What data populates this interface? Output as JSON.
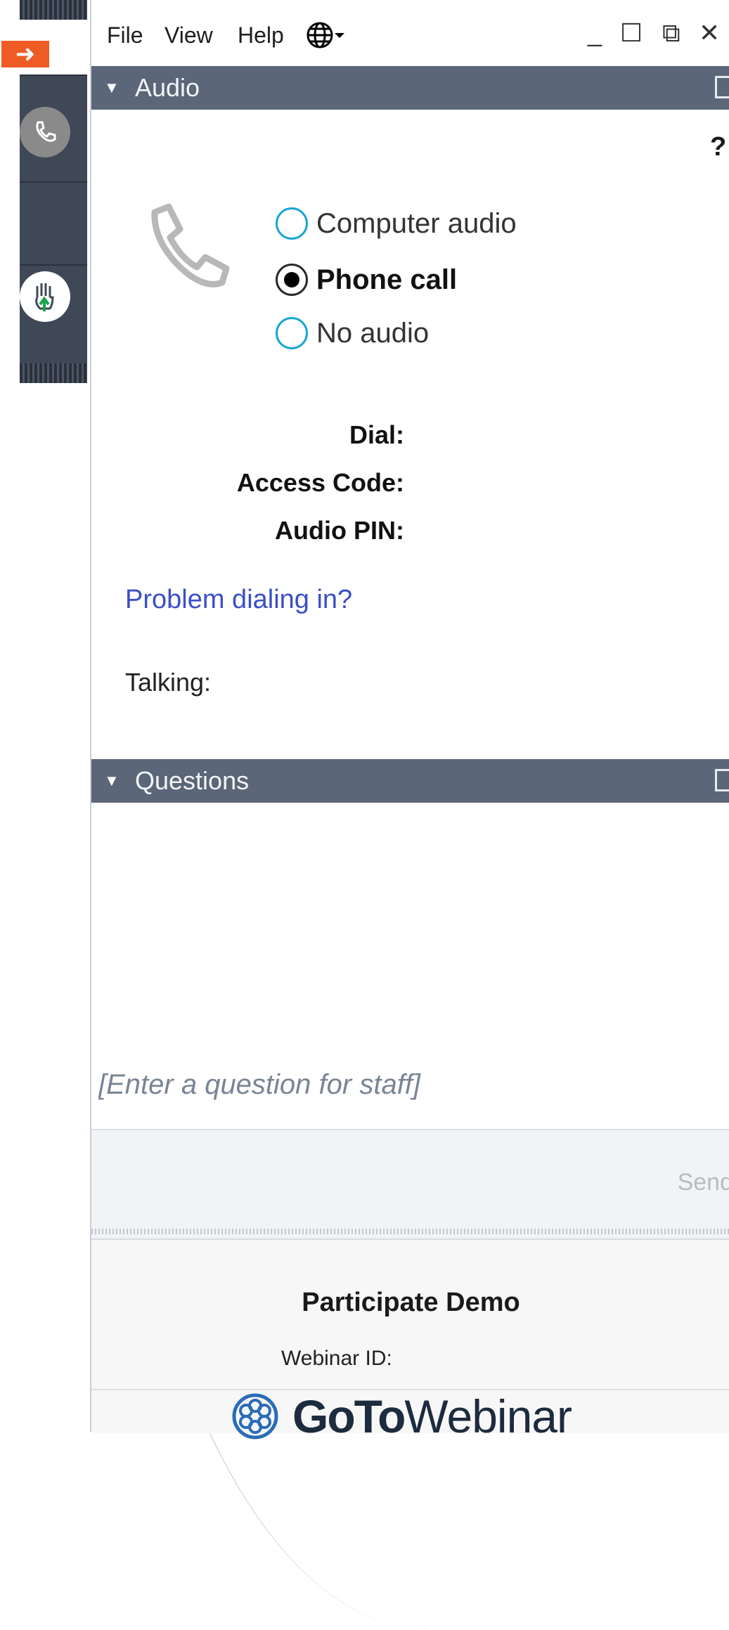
{
  "menu": {
    "file": "File",
    "view": "View",
    "help": "Help"
  },
  "window_controls": {
    "minimize": "_",
    "maximize": "☐",
    "popout": "⧉",
    "close": "✕"
  },
  "audio_panel": {
    "title": "Audio",
    "help": "?",
    "options": [
      {
        "label": "Computer audio",
        "selected": false
      },
      {
        "label": "Phone call",
        "selected": true
      },
      {
        "label": "No audio",
        "selected": false
      }
    ],
    "fields": {
      "dial": "Dial:",
      "access_code": "Access Code:",
      "audio_pin": "Audio PIN:"
    },
    "problem_link": "Problem dialing in?",
    "talking": "Talking:"
  },
  "questions_panel": {
    "title": "Questions",
    "placeholder": "[Enter a question for staff]",
    "send": "Send"
  },
  "footer": {
    "webinar_name": "Participate Demo",
    "webinar_id_label": "Webinar ID:",
    "brand_bold": "GoTo",
    "brand_regular": "Webinar"
  },
  "colors": {
    "panel_header": "#5b6678",
    "dock": "#3f4856",
    "accent_orange": "#ef5b25",
    "radio_blue": "#1aa4d8",
    "link": "#3b4fc9"
  },
  "icons": [
    "arrow-right-icon",
    "phone-icon",
    "window-icon",
    "raise-hand-icon",
    "globe-icon",
    "phone-handset-icon",
    "snowflake-logo-icon"
  ]
}
